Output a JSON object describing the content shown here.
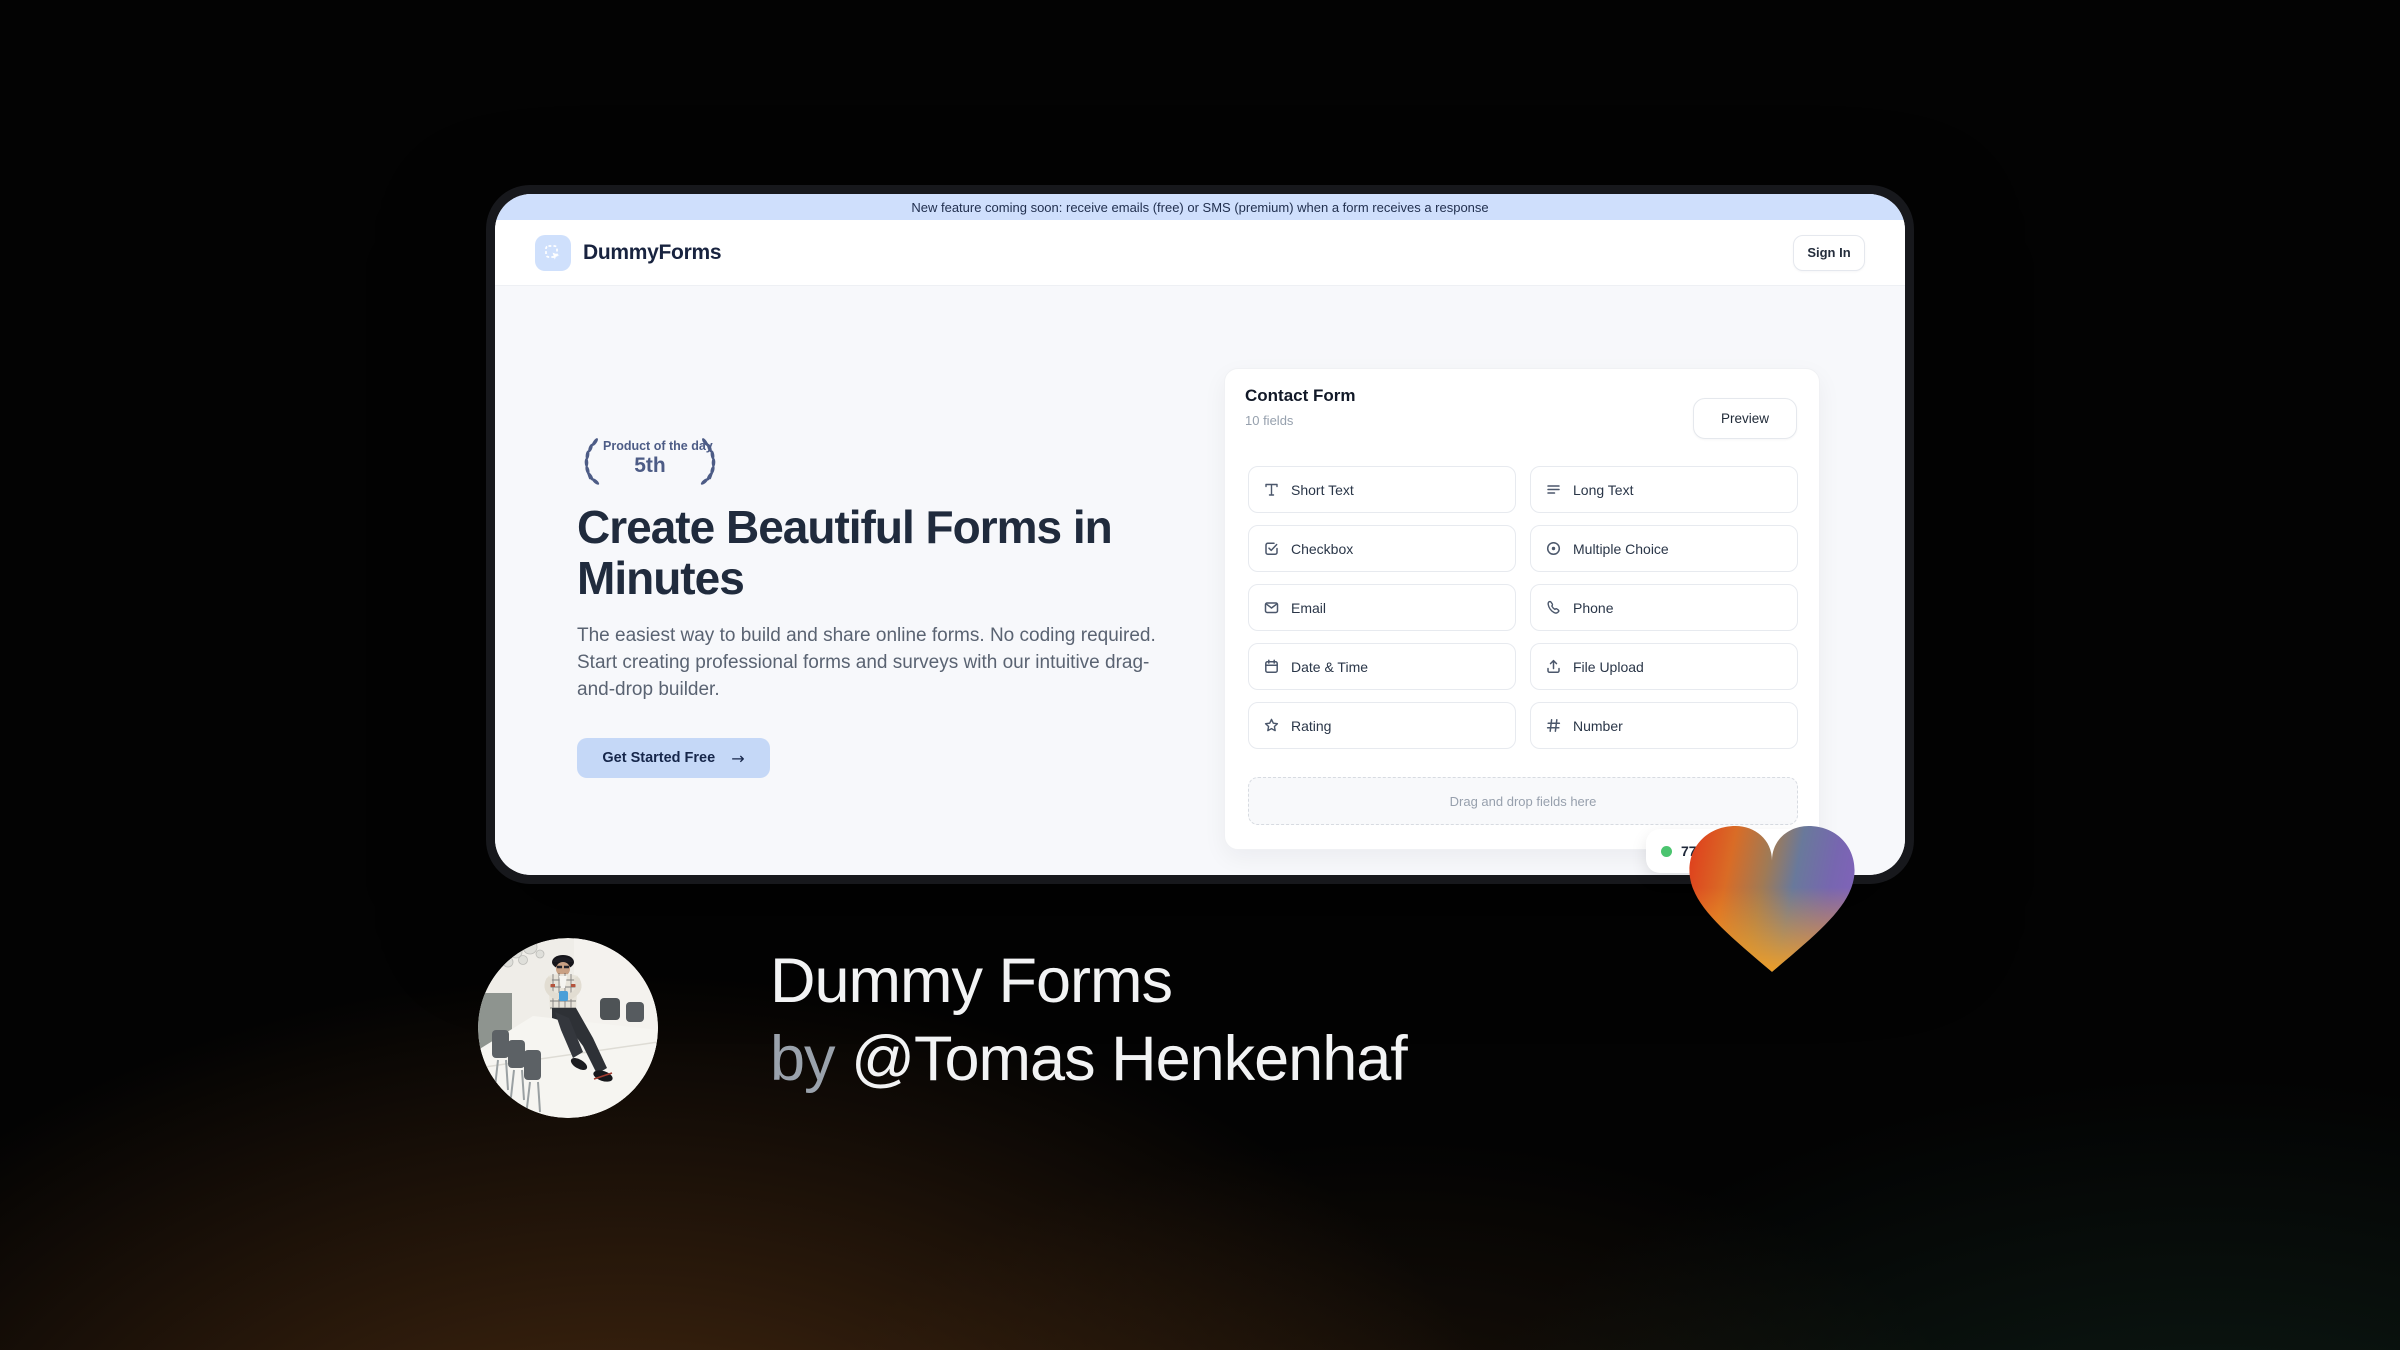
{
  "banner": {
    "text": "New feature coming soon: receive emails (free) or SMS (premium) when a form receives a response"
  },
  "header": {
    "brand": "DummyForms",
    "sign_in_label": "Sign In"
  },
  "hero": {
    "award_badge": {
      "line1": "Product of the day",
      "line2": "5th"
    },
    "title_lines": [
      "Create Beautiful Forms in",
      "Minutes"
    ],
    "description": "The easiest way to build and share online forms. No coding required. Start creating professional forms and surveys with our intuitive drag-and-drop builder.",
    "cta_label": "Get Started Free",
    "cta_arrow": "→"
  },
  "form_card": {
    "title": "Contact Form",
    "subtitle": "10 fields",
    "preview_label": "Preview",
    "fields": [
      {
        "label": "Short Text",
        "icon": "short-text-icon"
      },
      {
        "label": "Long Text",
        "icon": "long-text-icon"
      },
      {
        "label": "Checkbox",
        "icon": "checkbox-icon"
      },
      {
        "label": "Multiple Choice",
        "icon": "radio-icon"
      },
      {
        "label": "Email",
        "icon": "envelope-icon"
      },
      {
        "label": "Phone",
        "icon": "phone-icon"
      },
      {
        "label": "Date & Time",
        "icon": "calendar-icon"
      },
      {
        "label": "File Upload",
        "icon": "upload-icon"
      },
      {
        "label": "Rating",
        "icon": "star-icon"
      },
      {
        "label": "Number",
        "icon": "hash-icon"
      }
    ],
    "dropzone_text": "Drag and drop fields here",
    "live_badge": {
      "visible_text": "77"
    }
  },
  "footer": {
    "product_name": "Dummy Forms",
    "byline_prefix": "by",
    "author": "@Tomas Henkenhaf"
  },
  "colors": {
    "banner_bg": "#cfdffc",
    "cta_bg": "#c5d8f7",
    "brand_navy": "#1d2b4f",
    "hero_bg": "#f7f8fb",
    "laurel": "#4d5c86",
    "green_dot": "#4bc46f",
    "heart_left": "#e03a1c",
    "heart_right": "#7d64b6",
    "heart_bottom": "#f4a023"
  }
}
